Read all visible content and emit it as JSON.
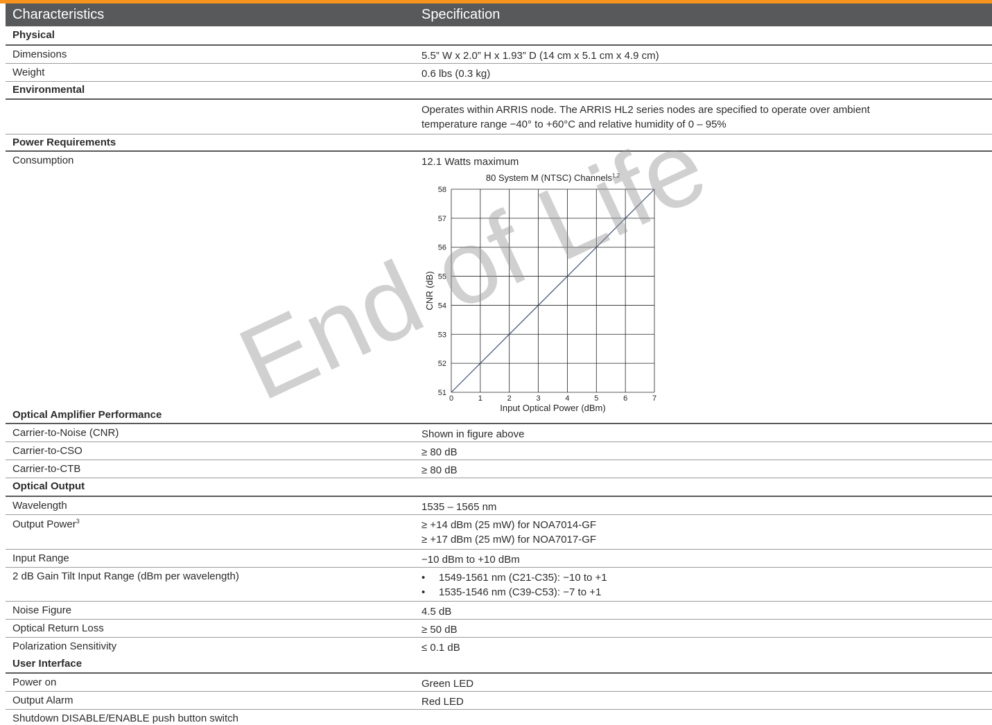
{
  "header": {
    "col1": "Characteristics",
    "col2": "Specification"
  },
  "sections": {
    "physical": "Physical",
    "environmental": "Environmental",
    "power": "Power Requirements",
    "optical_amp": "Optical Amplifier Performance",
    "optical_output": "Optical Output",
    "user_interface": "User Interface"
  },
  "rows": {
    "dimensions": {
      "label": "Dimensions",
      "value": "5.5” W x 2.0” H x 1.93” D (14 cm x 5.1 cm x 4.9 cm)"
    },
    "weight": {
      "label": "Weight",
      "value": "0.6 lbs (0.3 kg)"
    },
    "env_line1": "Operates within ARRIS node. The ARRIS HL2 series nodes are specified to operate over ambient",
    "env_line2": "temperature range −40° to +60°C and relative humidity of 0 – 95%",
    "consumption": {
      "label": "Consumption",
      "value": "12.1 Watts maximum"
    },
    "cnr": {
      "label": "Carrier-to-Noise (CNR)",
      "value": "Shown in figure above"
    },
    "cso": {
      "label": "Carrier-to-CSO",
      "value": "≥  80 dB"
    },
    "ctb": {
      "label": "Carrier-to-CTB",
      "value": "≥  80 dB"
    },
    "wavelength": {
      "label": "Wavelength",
      "value": "1535 – 1565 nm"
    },
    "output_power": {
      "label": "Output Power",
      "sup": "3",
      "line1": "≥ +14 dBm (25 mW) for NOA7014-GF",
      "line2": "≥ +17 dBm (25 mW) for NOA7017-GF"
    },
    "input_range": {
      "label": "Input Range",
      "value": "−10 dBm to +10 dBm"
    },
    "gain_tilt": {
      "label": "2 dB Gain Tilt Input Range (dBm per wavelength)",
      "bullet": "•",
      "line1": "1549-1561 nm (C21-C35): −10 to +1",
      "line2": "1535-1546 nm (C39-C53): −7 to +1"
    },
    "noise_figure": {
      "label": "Noise Figure",
      "value": "4.5 dB"
    },
    "return_loss": {
      "label": "Optical Return Loss",
      "value": "≥ 50 dB"
    },
    "polarization": {
      "label": "Polarization Sensitivity",
      "value": "≤ 0.1 dB"
    },
    "power_on": {
      "label": "Power on",
      "value": "Green LED"
    },
    "output_alarm": {
      "label": "Output Alarm",
      "value": "Red LED"
    },
    "shutdown": {
      "label": "Shutdown DISABLE/ENABLE push button switch"
    }
  },
  "watermark": "End of Life",
  "chart_data": {
    "type": "line",
    "title": "80 System M (NTSC) Channels",
    "title_sup": "1,2",
    "xlabel": "Input Optical Power (dBm)",
    "ylabel": "CNR (dB)",
    "xlim": [
      0,
      7
    ],
    "ylim": [
      51,
      58
    ],
    "xticks": [
      "0",
      "1",
      "2",
      "3",
      "4",
      "5",
      "6",
      "7"
    ],
    "yticks": [
      "51",
      "52",
      "53",
      "54",
      "55",
      "56",
      "57",
      "58"
    ],
    "grid": true,
    "series": [
      {
        "x": [
          0,
          7
        ],
        "y": [
          51,
          58
        ]
      }
    ],
    "line_color": "#3a4f6e"
  }
}
